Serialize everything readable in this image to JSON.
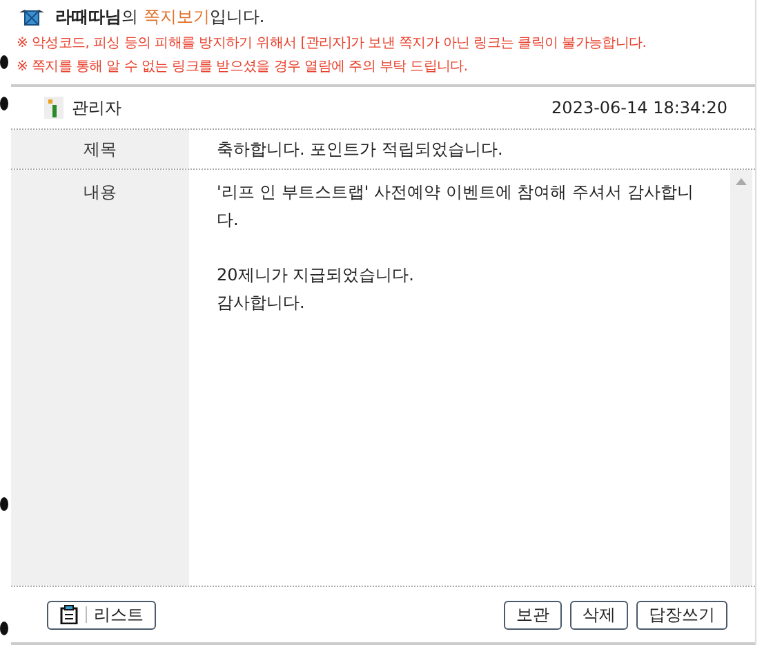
{
  "header": {
    "title_parts": [
      {
        "text": "라때따님",
        "kind": "name"
      },
      {
        "text": "의 ",
        "kind": "plain"
      },
      {
        "text": "쪽지보기",
        "kind": "accent"
      },
      {
        "text": "입니다.",
        "kind": "plain"
      }
    ],
    "notices": [
      "※ 악성코드, 피싱 등의 피해를 방지하기 위해서 [관리자]가 보낸 쪽지가 아닌 링크는 클릭이 불가능합니다.",
      "※ 쪽지를 통해 알 수 없는 링크를 받으셨을 경우 열람에 주의 부탁 드립니다."
    ]
  },
  "sender": {
    "name": "관리자",
    "datetime": "2023-06-14 18:34:20"
  },
  "fields": [
    {
      "label": "제목",
      "kind": "line",
      "value": "축하합니다. 포인트가 적립되었습니다."
    },
    {
      "label": "내용",
      "kind": "area",
      "value": "'리프 인 부트스트랩' 사전예약 이벤트에 참여해 주셔서 감사합니다.\n\n20제니가 지급되었습니다.\n감사합니다."
    }
  ],
  "footer": {
    "list_button": "리스트",
    "buttons": [
      "보관",
      "삭제",
      "답장쓰기"
    ]
  }
}
